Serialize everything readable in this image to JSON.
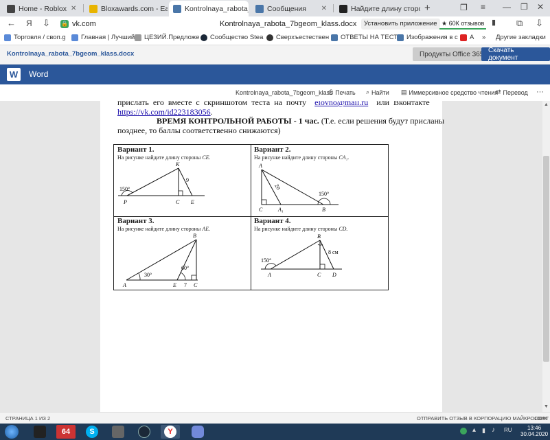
{
  "browser": {
    "tabs": [
      {
        "title": "Home - Roblox",
        "color": "#444"
      },
      {
        "title": "Bloxawards.com - Earn F",
        "color": "#e8b400"
      },
      {
        "title": "Kontrolnaya_rabota_7b",
        "color": "#4a76a8"
      },
      {
        "title": "Сообщения",
        "color": "#4a76a8"
      },
      {
        "title": "Найдите длину стороны",
        "color": "#222"
      }
    ],
    "address_host": "vk.com",
    "page_title": "Kontrolnaya_rabota_7bgeom_klass.docx",
    "install_app": "Установить приложение",
    "reviews": "★ 60К отзывов",
    "bookmarks": [
      "Торговля / своп.g",
      "Главная | Лучший",
      "ЦЕЗИЙ.Предложе",
      "Сообщество Stea",
      "Сверхъестествен",
      "ОТВЕТЫ НА ТЕСТЬ",
      "Изображения в с",
      "А"
    ],
    "other_bookmarks": "Другие закладки"
  },
  "office": {
    "filename": "Kontrolnaya_rabota_7bgeom_klass.docx",
    "products_btn": "Продукты Office 365",
    "download_btn": "Скачать документ",
    "app_name": "Word"
  },
  "doc_toolbar": {
    "filename": "Kontrolnaya_rabota_7bgeom_klass",
    "print": "Печать",
    "find": "Найти",
    "immersive": "Иммерсивное средство чтения",
    "translate": "Перевод",
    "more": "···"
  },
  "document": {
    "line1_a": "прислать его вместе с скриншотом теста на почту",
    "line1_link": "elovno@mail.ru",
    "line1_b": "или Вконтакте",
    "line2_link": "https://vk.com/id223183056",
    "line2_end": ".",
    "time_bold": "ВРЕМЯ КОНТРОЛЬНОЙ РАБОТЫ - 1 час.",
    "time_rest": "(Т.е. если решения будут присланы",
    "line4": "позднее, то баллы соответственно снижаются)",
    "variants": [
      {
        "title": "Вариант 1.",
        "task": "На рисунке найдите длину стороны",
        "target": "CE."
      },
      {
        "title": "Вариант 2.",
        "task": "На   рисунке   найдите   длину   стороны",
        "target": "CA₁."
      },
      {
        "title": "Вариант 3.",
        "task": "На рисунке найдите длину стороны",
        "target": "AE."
      },
      {
        "title": "Вариант 4.",
        "task": "На рисунке найдите длину стороны",
        "target": "CD."
      }
    ],
    "fig1": {
      "K": "K",
      "P": "P",
      "C": "C",
      "E": "E",
      "angle": "150°",
      "side": "9"
    },
    "fig2": {
      "A": "A",
      "C": "C",
      "A1": "A₁",
      "B": "B",
      "angle": "150°",
      "side": "20"
    },
    "fig3": {
      "A": "A",
      "B": "B",
      "E": "E",
      "C": "C",
      "a30": "30°",
      "a60": "60°",
      "seg": "7"
    },
    "fig4": {
      "A": "A",
      "B": "B",
      "C": "C",
      "D": "D",
      "angle": "150°",
      "side": "8 см"
    }
  },
  "status": {
    "page": "СТРАНИЦА 1 ИЗ 2",
    "feedback": "ОТПРАВИТЬ ОТЗЫВ В КОРПОРАЦИЮ МАЙКРОСОФТ",
    "zoom": "100%"
  },
  "taskbar": {
    "time": "13:46",
    "date": "30.04.2020",
    "lang": "RU"
  }
}
